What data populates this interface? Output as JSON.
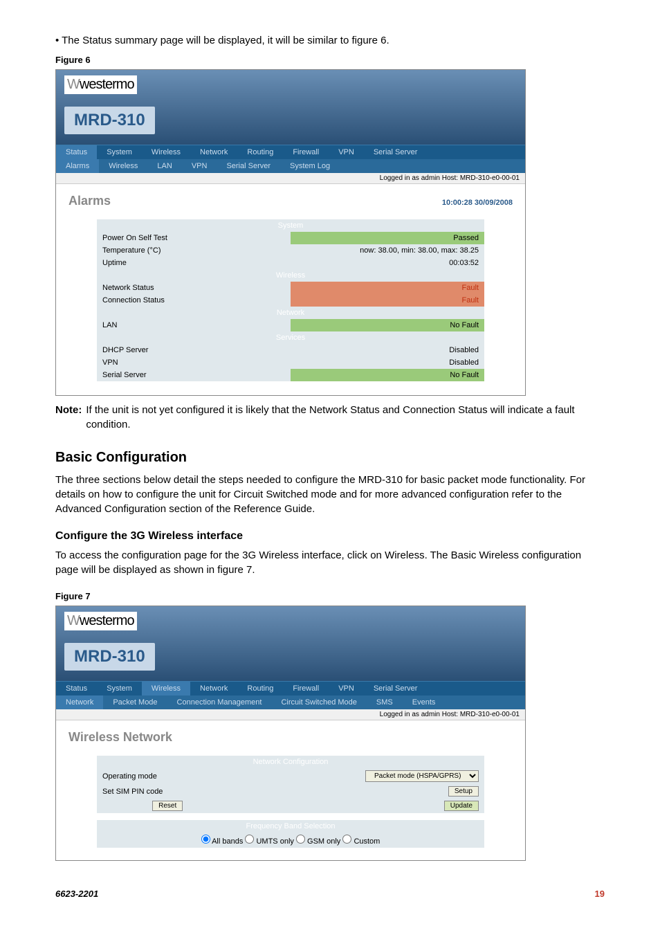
{
  "intro_bullet": "• The Status summary page will be displayed, it will be similar to figure 6.",
  "figure6_label": "Figure 6",
  "logo_text": "westermo",
  "device_name": "MRD-310",
  "tabs_row1": {
    "status": "Status",
    "system": "System",
    "wireless": "Wireless",
    "network": "Network",
    "routing": "Routing",
    "firewall": "Firewall",
    "vpn": "VPN",
    "serial": "Serial Server"
  },
  "tabs_row2_fig6": {
    "alarms": "Alarms",
    "wireless": "Wireless",
    "lan": "LAN",
    "vpn": "VPN",
    "serial": "Serial Server",
    "syslog": "System Log"
  },
  "login_text": "Logged in as admin Host: MRD-310-e0-00-01",
  "alarms_title": "Alarms",
  "alarms_timestamp": "10:00:28 30/09/2008",
  "sections": {
    "system": "System",
    "wireless": "Wireless",
    "network": "Network",
    "services": "Services"
  },
  "rows": {
    "post": {
      "label": "Power On Self Test",
      "value": "Passed"
    },
    "temp": {
      "label": "Temperature (°C)",
      "value": "now: 38.00, min: 38.00, max: 38.25"
    },
    "uptime": {
      "label": "Uptime",
      "value": "00:03:52"
    },
    "netstatus": {
      "label": "Network Status",
      "value": "Fault"
    },
    "connstatus": {
      "label": "Connection Status",
      "value": "Fault"
    },
    "lan": {
      "label": "LAN",
      "value": "No Fault"
    },
    "dhcp": {
      "label": "DHCP Server",
      "value": "Disabled"
    },
    "vpn": {
      "label": "VPN",
      "value": "Disabled"
    },
    "ssrv": {
      "label": "Serial Server",
      "value": "No Fault"
    }
  },
  "note_label": "Note:",
  "note_text": "If the unit is not yet configured it is likely that the Network Status and Connection Status will indicate a fault condition.",
  "basic_heading": "Basic Configuration",
  "basic_para": "The three sections below detail the steps needed to configure the MRD-310 for basic packet mode functionality. For details on how to configure the unit for Circuit Switched mode and for more advanced configuration refer to the Advanced Configuration section of the Reference Guide.",
  "configure_heading": "Configure the 3G Wireless interface",
  "configure_p1": "To access the configuration page for the 3G Wireless interface, click on Wireless. The Basic Wireless configuration page will be displayed as shown in figure 7.",
  "figure7_label": "Figure 7",
  "tabs_row2_fig7": {
    "network": "Network",
    "packet": "Packet Mode",
    "conn": "Connection Management",
    "csm": "Circuit Switched Mode",
    "sms": "SMS",
    "events": "Events"
  },
  "wn_title": "Wireless Network",
  "net_config_header": "Network Configuration",
  "opmode_label": "Operating mode",
  "opmode_value": "Packet mode (HSPA/GPRS)",
  "simpin_label": "Set SIM PIN code",
  "setup_btn": "Setup",
  "reset_btn": "Reset",
  "update_btn": "Update",
  "freq_header": "Frequency Band Selection",
  "radio_all": "All bands",
  "radio_umts": "UMTS only",
  "radio_gsm": "GSM only",
  "radio_custom": "Custom",
  "footer_left": "6623-2201",
  "footer_right": "19"
}
